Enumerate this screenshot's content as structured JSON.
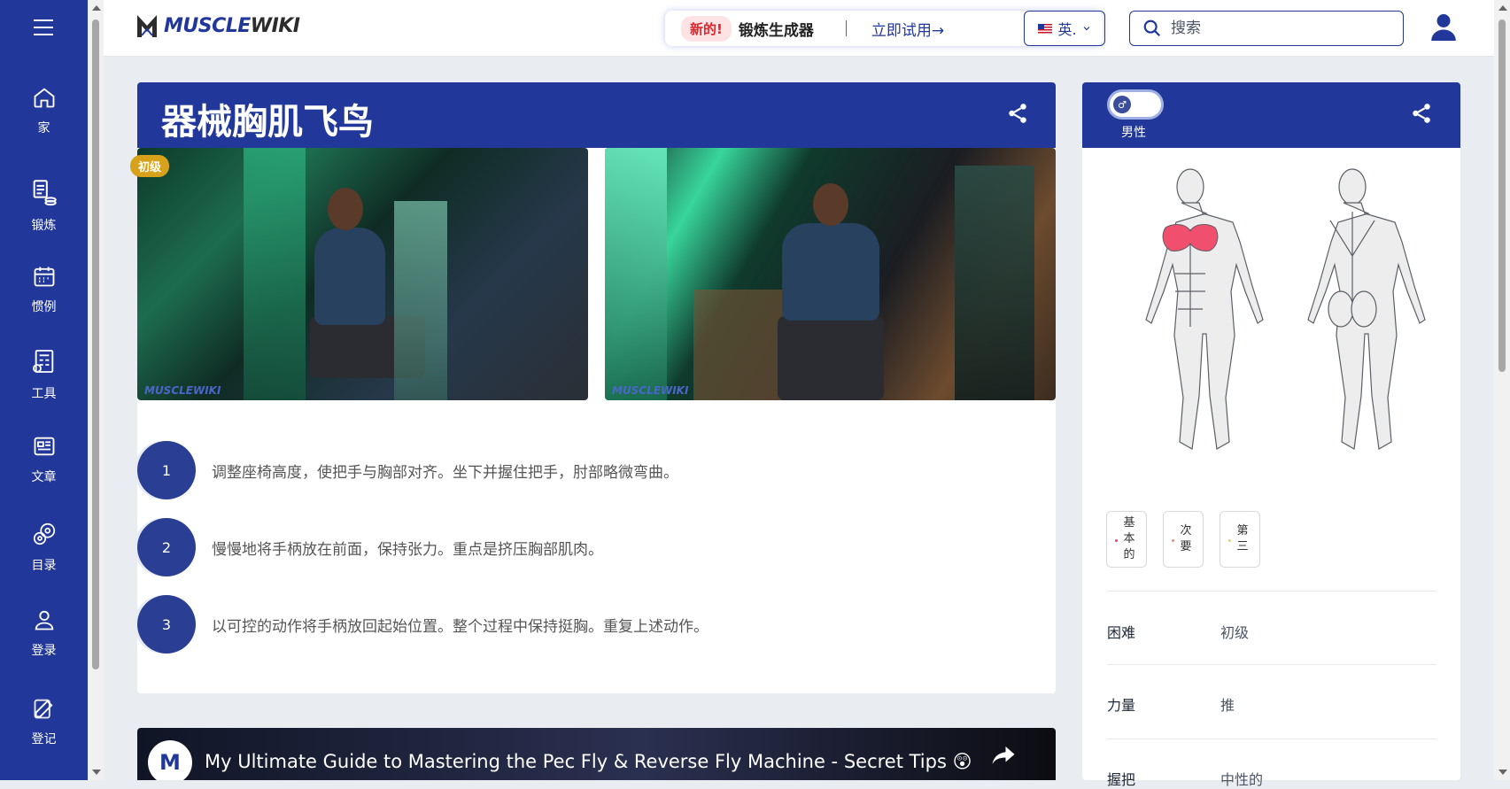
{
  "sidebar": {
    "items": [
      {
        "label": "家",
        "icon": "home-icon"
      },
      {
        "label": "锻炼",
        "icon": "workout-icon"
      },
      {
        "label": "惯例",
        "icon": "calendar-icon"
      },
      {
        "label": "工具",
        "icon": "tools-icon"
      },
      {
        "label": "文章",
        "icon": "article-icon"
      },
      {
        "label": "目录",
        "icon": "directory-icon"
      },
      {
        "label": "登录",
        "icon": "user-icon"
      },
      {
        "label": "登记",
        "icon": "edit-icon"
      }
    ]
  },
  "header": {
    "logo_main": "MUSCLE",
    "logo_accent": "WIKI",
    "promo_new": "新的!",
    "promo_title": "锻炼生成器",
    "promo_cta": "立即试用→",
    "language": "英.",
    "search_placeholder": "搜索"
  },
  "exercise": {
    "title": "器械胸肌飞鸟",
    "level_badge": "初级",
    "video_watermark": "MUSCLEWIKI",
    "steps": [
      {
        "num": "1",
        "text": "调整座椅高度，使把手与胸部对齐。坐下并握住把手，肘部略微弯曲。"
      },
      {
        "num": "2",
        "text": "慢慢地将手柄放在前面，保持张力。重点是挤压胸部肌肉。"
      },
      {
        "num": "3",
        "text": "以可控的动作将手柄放回起始位置。整个过程中保持挺胸。重复上述动作。"
      }
    ]
  },
  "youtube": {
    "title": "My Ultimate Guide to Mastering the Pec Fly & Reverse Fly Machine - Secret Tips 😲",
    "share_label": "分享"
  },
  "side": {
    "gender_label": "男性",
    "muscle_buttons": [
      {
        "label": "基本的",
        "dot_color": "#e8425a"
      },
      {
        "label": "次要",
        "dot_color": "#f08a6b"
      },
      {
        "label": "第三",
        "dot_color": "#f4c96a"
      }
    ],
    "info": [
      {
        "label": "困难",
        "value": "初级"
      },
      {
        "label": "力量",
        "value": "推"
      },
      {
        "label": "握把",
        "value": "中性的"
      }
    ]
  },
  "colors": {
    "brand_blue": "#21389a",
    "highlight_muscle": "#f0506e",
    "badge_gold": "#d7a21a"
  }
}
